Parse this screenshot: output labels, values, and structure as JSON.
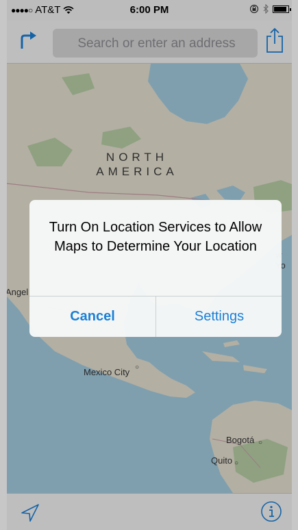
{
  "status_bar": {
    "signal": "●●●●○",
    "carrier": "AT&T",
    "time": "6:00 PM"
  },
  "nav": {
    "search_placeholder": "Search or enter an address",
    "directions_icon": "directions-arrow-icon",
    "share_icon": "share-icon"
  },
  "map": {
    "continent_line1": "NORTH",
    "continent_line2": "AMERICA",
    "cities": {
      "angel": "Angel",
      "new_york_partial": "w Yo",
      "mexico_city": "Mexico City",
      "bogota": "Bogotá",
      "quito": "Quito"
    }
  },
  "alert": {
    "title": "Turn On Location Services to Allow Maps to Determine Your Location",
    "cancel_label": "Cancel",
    "settings_label": "Settings"
  },
  "toolbar": {
    "location_icon": "location-arrow-icon",
    "info_icon": "info-icon"
  },
  "colors": {
    "accent": "#1a7fd6",
    "water": "#9fc9dd",
    "land": "#e8e3d4"
  }
}
